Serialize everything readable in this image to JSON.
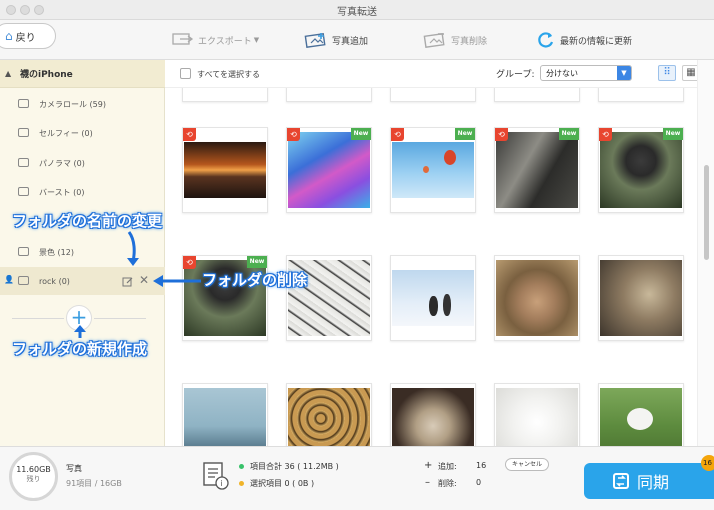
{
  "window": {
    "title": "写真転送"
  },
  "toolbar": {
    "back_label": "戻り",
    "export_label": "エクスポート",
    "add_label": "写真追加",
    "delete_label": "写真削除",
    "refresh_label": "最新の情報に更新"
  },
  "sidebar": {
    "device_name": "襪のiPhone",
    "albums": [
      {
        "label": "カメラロール (59)"
      },
      {
        "label": "セルフィー (0)"
      },
      {
        "label": "パノラマ (0)"
      },
      {
        "label": "バースト (0)"
      },
      {
        "label": "景色 (12)"
      },
      {
        "label": "rock (0)"
      }
    ]
  },
  "content_bar": {
    "select_all_label": "すべてを選択する",
    "group_label": "グループ:",
    "group_value": "分けない"
  },
  "badges": {
    "new": "New",
    "return_icon": "return-icon"
  },
  "footer": {
    "storage_value": "11.60GB",
    "storage_label": "残り",
    "media_label": "写真",
    "media_detail": "91項目 / 16GB",
    "total_items": "項目合計 36 ( 11.2MB )",
    "selected_items": "選択項目 0 ( 0B )",
    "add_label": "追加:",
    "add_count": "16",
    "delete_label": "削除:",
    "delete_count": "0",
    "cancel_label": "キャンセル",
    "sync_label": "同期",
    "sync_badge": "16"
  },
  "annotations": {
    "rename": "フォルダの名前の変更",
    "delete": "フォルダの削除",
    "create": "フォルダの新規作成"
  },
  "colors": {
    "accent": "#2aa4ea",
    "badge_new": "#4caf50",
    "badge_return": "#e8452f",
    "annotation": "#1e6fd9"
  }
}
